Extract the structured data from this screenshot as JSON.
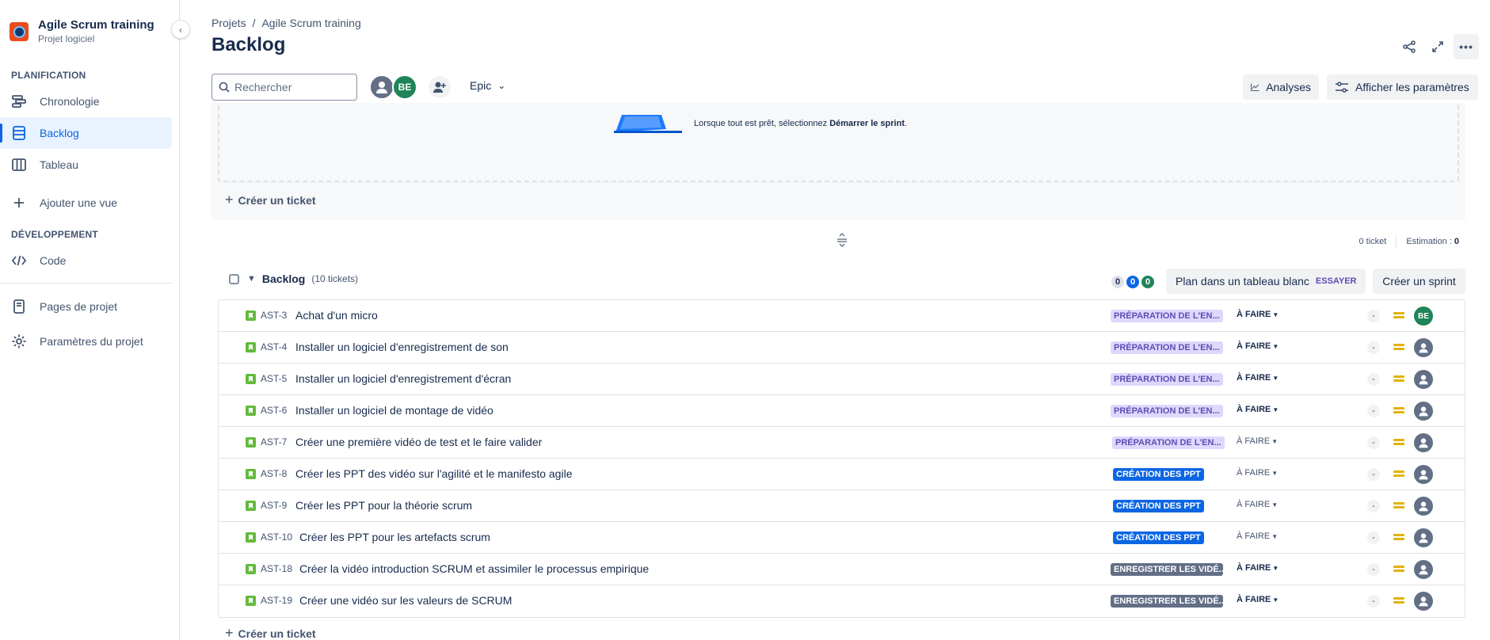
{
  "sidebar": {
    "project_name": "Agile Scrum training",
    "project_type": "Projet logiciel",
    "planning_title": "PLANIFICATION",
    "planning_items": [
      {
        "label": "Chronologie"
      },
      {
        "label": "Backlog"
      },
      {
        "label": "Tableau"
      }
    ],
    "add_view": "Ajouter une vue",
    "dev_title": "DÉVELOPPEMENT",
    "code": "Code",
    "project_pages": "Pages de projet",
    "project_settings": "Paramètres du projet"
  },
  "header": {
    "breadcrumb_projects": "Projets",
    "breadcrumb_separator": "/",
    "breadcrumb_project": "Agile Scrum training",
    "title": "Backlog"
  },
  "toolbar": {
    "search_placeholder": "Rechercher",
    "avatar_be": "BE",
    "epic_label": "Epic",
    "analyses": "Analyses",
    "show_settings": "Afficher les paramètres"
  },
  "sprint": {
    "message_prefix": "Lorsque tout est prêt, sélectionnez ",
    "message_bold": "Démarrer le sprint",
    "message_suffix": ".",
    "create_ticket": "Créer un ticket",
    "ticket_count": "0 ticket",
    "estimate_label": "Estimation :",
    "estimate_value": "0"
  },
  "backlog": {
    "title": "Backlog",
    "count": "(10 tickets)",
    "counter_todo": "0",
    "counter_progress": "0",
    "counter_done": "0",
    "plan_button": "Plan dans un tableau blanc",
    "try_label": "ESSAYER",
    "create_sprint": "Créer un sprint",
    "create_ticket": "Créer un ticket",
    "issues": [
      {
        "key": "AST-3",
        "summary": "Achat d'un micro",
        "epic": "PRÉPARATION DE L'EN...",
        "status": "À FAIRE",
        "estimate": "-",
        "assignee": "BE"
      },
      {
        "key": "AST-4",
        "summary": "Installer un logiciel d'enregistrement de son",
        "epic": "PRÉPARATION DE L'EN...",
        "status": "À FAIRE",
        "estimate": "-",
        "assignee": ""
      },
      {
        "key": "AST-5",
        "summary": "Installer un logiciel d'enregistrement d'écran",
        "epic": "PRÉPARATION DE L'EN...",
        "status": "À FAIRE",
        "estimate": "-",
        "assignee": ""
      },
      {
        "key": "AST-6",
        "summary": "Installer un logiciel de montage de vidéo",
        "epic": "PRÉPARATION DE L'EN...",
        "status": "À FAIRE",
        "estimate": "-",
        "assignee": ""
      },
      {
        "key": "AST-7",
        "summary": "Créer une première vidéo de test et le faire valider",
        "epic": "PRÉPARATION DE L'EN...",
        "status": "À FAIRE",
        "estimate": "-",
        "assignee": ""
      },
      {
        "key": "AST-8",
        "summary": "Créer les PPT des vidéo sur l'agilité et le manifesto agile",
        "epic": "CRÉATION DES PPT",
        "status": "À FAIRE",
        "estimate": "-",
        "assignee": ""
      },
      {
        "key": "AST-9",
        "summary": "Créer les PPT pour la théorie scrum",
        "epic": "CRÉATION DES PPT",
        "status": "À FAIRE",
        "estimate": "-",
        "assignee": ""
      },
      {
        "key": "AST-10",
        "summary": "Créer les PPT pour les artefacts scrum",
        "epic": "CRÉATION DES PPT",
        "status": "À FAIRE",
        "estimate": "-",
        "assignee": ""
      },
      {
        "key": "AST-18",
        "summary": "Créer la vidéo introduction SCRUM et assimiler le processus empirique",
        "epic": "ENREGISTRER LES VIDÉ...",
        "status": "À FAIRE",
        "estimate": "-",
        "assignee": ""
      },
      {
        "key": "AST-19",
        "summary": "Créer une vidéo sur les valeurs de SCRUM",
        "epic": "ENREGISTRER LES VIDÉ...",
        "status": "À FAIRE",
        "estimate": "-",
        "assignee": ""
      }
    ]
  },
  "colors": {
    "accent": "#0c66e4",
    "epic_purple_bg": "#dfd8fd",
    "epic_blue_bg": "#0c66e4",
    "epic_gray_bg": "#626f86",
    "story_green": "#63ba3c",
    "priority_medium": "#e2b203"
  },
  "icons": {
    "sidebar": [
      "timeline-icon",
      "backlog-icon",
      "board-icon",
      "plus-icon",
      "code-icon",
      "pages-icon",
      "settings-gear-icon"
    ],
    "top_right": [
      "share-icon",
      "fullscreen-icon",
      "more-icon"
    ],
    "row": [
      "story-icon",
      "priority-medium-icon",
      "avatar-icon"
    ]
  }
}
